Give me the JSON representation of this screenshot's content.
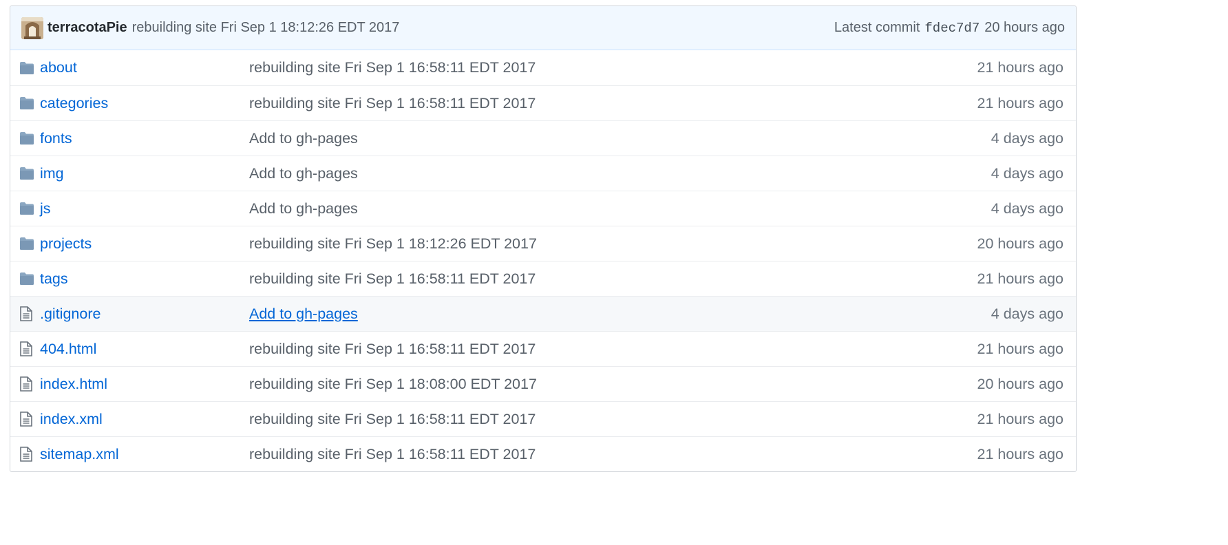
{
  "latest_commit": {
    "author": "terracotaPie",
    "message": "rebuilding site Fri Sep 1 18:12:26 EDT 2017",
    "label": "Latest commit",
    "sha": "fdec7d7",
    "age": "20 hours ago"
  },
  "files": [
    {
      "type": "folder",
      "icon": "folder-icon",
      "name": "about",
      "message": "rebuilding site Fri Sep 1 16:58:11 EDT 2017",
      "age": "21 hours ago"
    },
    {
      "type": "folder",
      "icon": "folder-icon",
      "name": "categories",
      "message": "rebuilding site Fri Sep 1 16:58:11 EDT 2017",
      "age": "21 hours ago"
    },
    {
      "type": "folder",
      "icon": "folder-icon",
      "name": "fonts",
      "message": "Add to gh-pages",
      "age": "4 days ago"
    },
    {
      "type": "folder",
      "icon": "folder-icon",
      "name": "img",
      "message": "Add to gh-pages",
      "age": "4 days ago"
    },
    {
      "type": "folder",
      "icon": "folder-icon",
      "name": "js",
      "message": "Add to gh-pages",
      "age": "4 days ago"
    },
    {
      "type": "folder",
      "icon": "folder-icon",
      "name": "projects",
      "message": "rebuilding site Fri Sep 1 18:12:26 EDT 2017",
      "age": "20 hours ago"
    },
    {
      "type": "folder",
      "icon": "folder-icon",
      "name": "tags",
      "message": "rebuilding site Fri Sep 1 16:58:11 EDT 2017",
      "age": "21 hours ago"
    },
    {
      "type": "file",
      "icon": "file-icon",
      "name": ".gitignore",
      "message": "Add to gh-pages",
      "age": "4 days ago",
      "hovered": true
    },
    {
      "type": "file",
      "icon": "file-icon",
      "name": "404.html",
      "message": "rebuilding site Fri Sep 1 16:58:11 EDT 2017",
      "age": "21 hours ago"
    },
    {
      "type": "file",
      "icon": "file-icon",
      "name": "index.html",
      "message": "rebuilding site Fri Sep 1 18:08:00 EDT 2017",
      "age": "20 hours ago"
    },
    {
      "type": "file",
      "icon": "file-icon",
      "name": "index.xml",
      "message": "rebuilding site Fri Sep 1 16:58:11 EDT 2017",
      "age": "21 hours ago"
    },
    {
      "type": "file",
      "icon": "file-icon",
      "name": "sitemap.xml",
      "message": "rebuilding site Fri Sep 1 16:58:11 EDT 2017",
      "age": "21 hours ago"
    }
  ],
  "colors": {
    "link": "#0366d6",
    "muted": "#586069",
    "folder_icon": "#79b8ff",
    "commit_bar_bg": "#f1f8ff"
  }
}
